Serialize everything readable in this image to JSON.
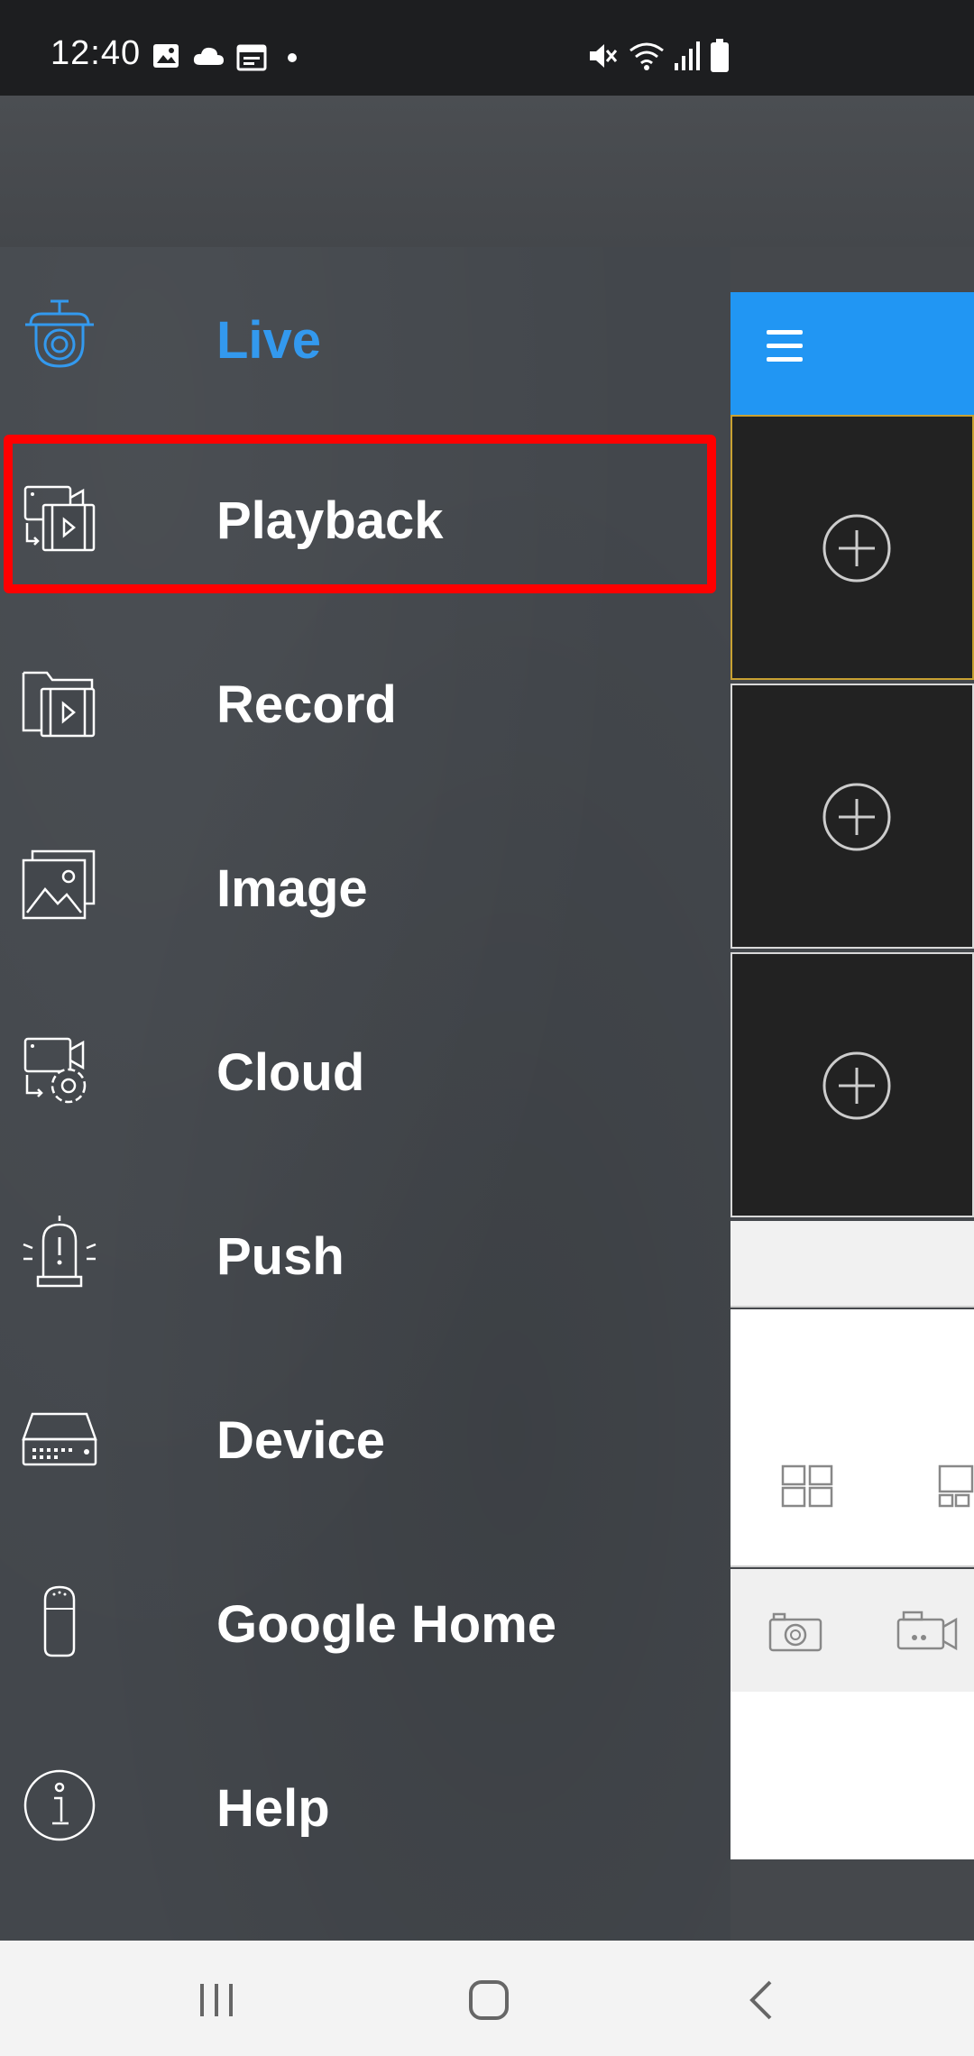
{
  "status_bar": {
    "time": "12:40",
    "left_icons": [
      "image-icon",
      "cloud-icon",
      "calendar-icon",
      "dot-icon"
    ],
    "right_icons": [
      "mute-icon",
      "wifi-icon",
      "signal-icon",
      "battery-icon"
    ]
  },
  "drawer": {
    "items": [
      {
        "label": "Live",
        "icon": "camera-icon",
        "active": true
      },
      {
        "label": "Playback",
        "icon": "playback-icon",
        "highlighted": true
      },
      {
        "label": "Record",
        "icon": "record-folder-icon"
      },
      {
        "label": "Image",
        "icon": "image-gallery-icon"
      },
      {
        "label": "Cloud",
        "icon": "cloud-settings-icon"
      },
      {
        "label": "Push",
        "icon": "alarm-icon"
      },
      {
        "label": "Device",
        "icon": "dvr-device-icon"
      },
      {
        "label": "Google Home",
        "icon": "google-home-icon"
      },
      {
        "label": "Help",
        "icon": "info-icon"
      }
    ]
  },
  "right_panel": {
    "top_bar_color": "#2196f3",
    "tiles": [
      "add-channel",
      "add-channel",
      "add-channel"
    ]
  },
  "colors": {
    "active": "#3399ee",
    "highlight": "#ff0000",
    "drawer_bg": "#43474c"
  }
}
